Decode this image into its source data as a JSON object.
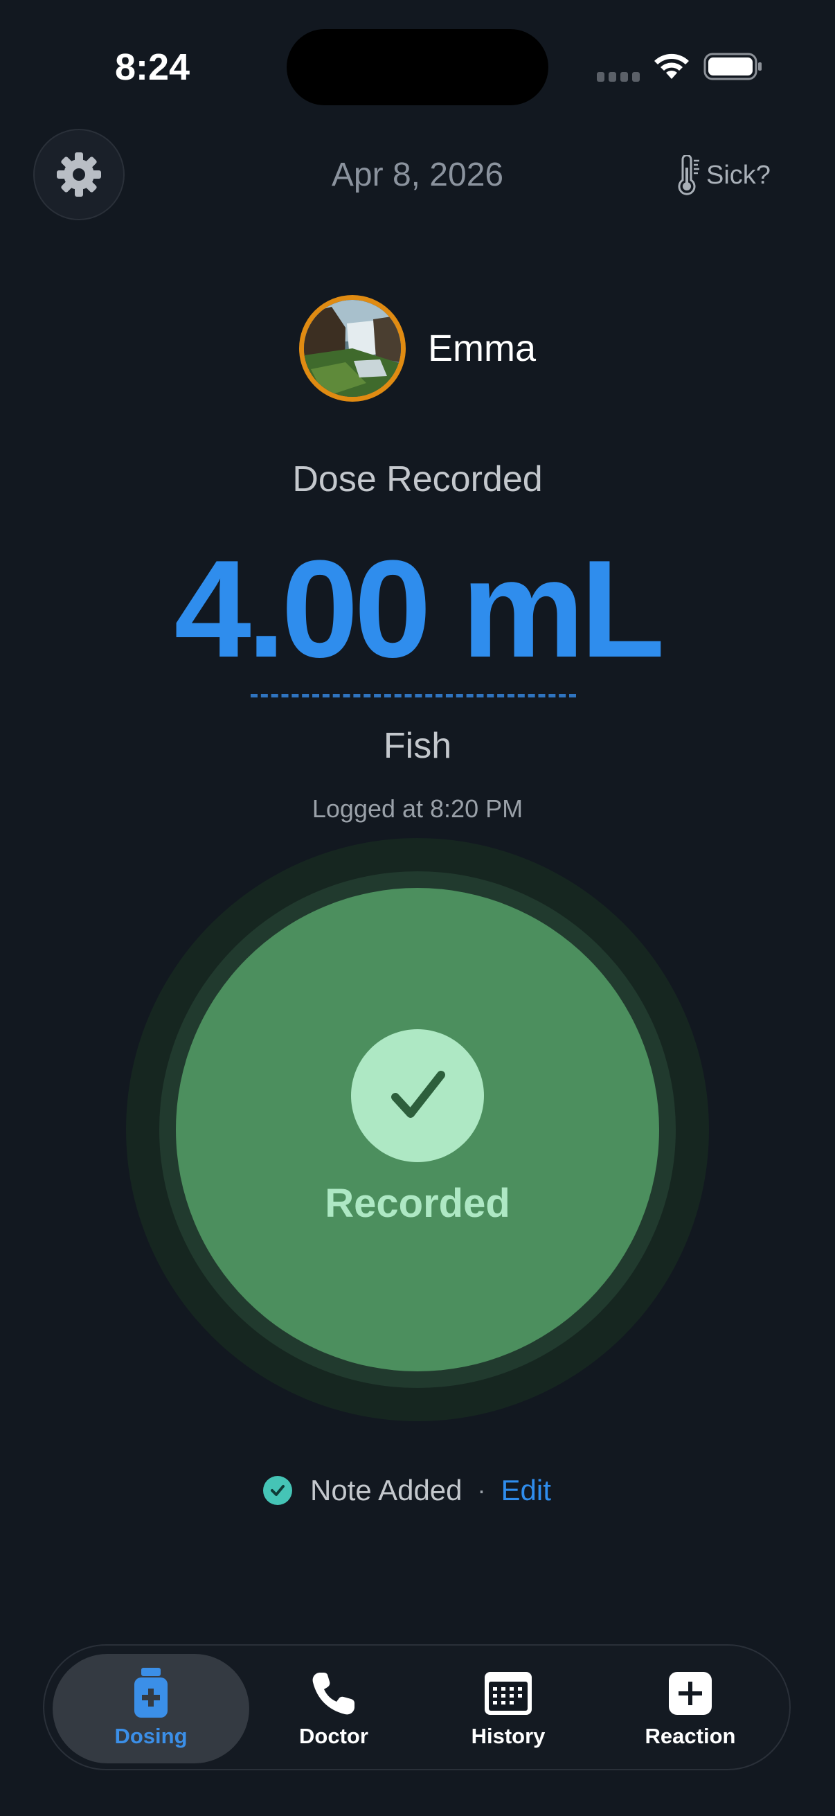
{
  "status_bar": {
    "time": "8:24"
  },
  "header": {
    "date": "Apr 8, 2026",
    "sick_label": "Sick?",
    "settings_icon": "gear-icon",
    "sick_icon": "thermometer-icon"
  },
  "profile": {
    "name": "Emma",
    "avatar_ring_color": "#e08b12"
  },
  "dose": {
    "status_label": "Dose Recorded",
    "amount": "4.00 mL",
    "allergen": "Fish",
    "logged_at": "Logged at 8:20 PM",
    "accent_color": "#2f8ded"
  },
  "record_button": {
    "label": "Recorded",
    "icon": "checkmark-icon",
    "color": "#4c8f5e"
  },
  "note": {
    "status": "Note Added",
    "separator": "·",
    "edit_label": "Edit"
  },
  "tab_bar": {
    "tabs": [
      {
        "label": "Dosing",
        "icon": "medicine-bottle-icon",
        "active": true
      },
      {
        "label": "Doctor",
        "icon": "phone-icon",
        "active": false
      },
      {
        "label": "History",
        "icon": "calendar-icon",
        "active": false
      },
      {
        "label": "Reaction",
        "icon": "plus-square-icon",
        "active": false
      }
    ]
  }
}
